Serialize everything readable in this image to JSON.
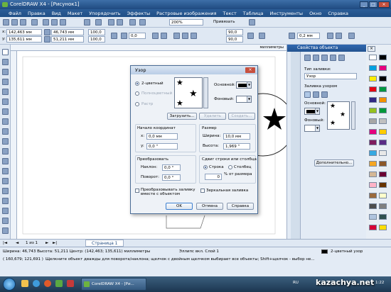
{
  "window": {
    "title": "CorelDRAW X4 - [Рисунок1]",
    "buttons": [
      "_",
      "□",
      "×"
    ]
  },
  "menu": [
    "Файл",
    "Правка",
    "Вид",
    "Макет",
    "Упорядочить",
    "Эффекты",
    "Растровые изображения",
    "Текст",
    "Таблица",
    "Инструменты",
    "Окно",
    "Справка"
  ],
  "toolbar": {
    "zoom": "200%",
    "snap": "Привязать",
    "x": "142,463 мм",
    "y": "135,611 мм",
    "w": "46,743 мм",
    "h": "51,211 мм",
    "scale_w": "100,0",
    "scale_h": "100,0",
    "angle": "0,0",
    "corner1": "90,0",
    "corner2": "90,0",
    "outline": "0,2 мм"
  },
  "rulers": {
    "top_unit": "миллиметры"
  },
  "dialog": {
    "title": "Узор",
    "radio_2color": "2-цветный",
    "radio_full": "Полноцветный",
    "radio_raster": "Растр",
    "front_label": "Основной:",
    "back_label": "Фоновый:",
    "load_btn": "Загрузить...",
    "delete_btn": "Удалить",
    "create_btn": "Создать...",
    "origin_title": "Начало координат",
    "origin_x_label": "x:",
    "origin_x": "0,0 мм",
    "origin_y_label": "y:",
    "origin_y": "0,0 \"",
    "size_title": "Размер",
    "width_label": "Ширина:",
    "width": "10,0 мм",
    "height_label": "Высота:",
    "height": "1,969 \"",
    "transform_title": "Преобразовать",
    "skew_label": "Наклон:",
    "skew": "0,0 °",
    "rotate_label": "Поворот:",
    "rotate": "0,0 °",
    "offset_title": "Сдвиг строки или столбца",
    "row_label": "Строка",
    "col_label": "Столбец",
    "offset_value": "0",
    "offset_unit": "% от размера",
    "transform_fill_check": "Преобразовывать заливку вместе с объектом",
    "mirror_check": "Зеркальная заливка",
    "ok": "OK",
    "cancel": "Отмена",
    "help": "Справка"
  },
  "docker": {
    "title": "Свойства объекта",
    "fill_type_label": "Тип заливки:",
    "fill_type": "Узор",
    "pattern_fill_label": "Заливка узором",
    "front_label": "Основной:",
    "back_label": "Фоновый:",
    "more_btn": "Дополнительно..."
  },
  "pagebar": {
    "pages": "1 из 1",
    "page_tab": "Страница 1"
  },
  "status": {
    "line1": "Ширина: 46,743  Высота: 51,211  Центр: (142,463; 135,611)  миллиметры",
    "object": "Эллипс вкл. Слой 1",
    "line2": "( 160,679; 121,691 )",
    "hint": "Щелкните объект дважды для поворота/наклона; щелчок с двойным щелчком выбирает все объекты; Shift+щелчок - выбор не...",
    "fill_name": "2-цветный узор"
  },
  "taskbar": {
    "app": "CorelDRAW X4 - [Ри...",
    "lang": "RU",
    "clock": "1:22",
    "watermark": "kazachya.net"
  },
  "palette_colors": [
    "#ffffff",
    "#000000",
    "#00a0e0",
    "#e6007e",
    "#ffed00",
    "#000000",
    "#e30613",
    "#009640",
    "#312783",
    "#f39200",
    "#95c11f",
    "#00983a",
    "#a6a6a6",
    "#c0c0c0",
    "#e5007d",
    "#ffcc00",
    "#7f1d5e",
    "#5b2d86",
    "#36a9e1",
    "#e8e8e8",
    "#f5a623",
    "#8b572a",
    "#d4b896",
    "#6a0032",
    "#ffb3c7",
    "#663300",
    "#9b6a3c",
    "#ffffcc",
    "#4d4d4d",
    "#808080",
    "#b0c4de",
    "#2f4f4f",
    "#d70036",
    "#ffdd00"
  ]
}
